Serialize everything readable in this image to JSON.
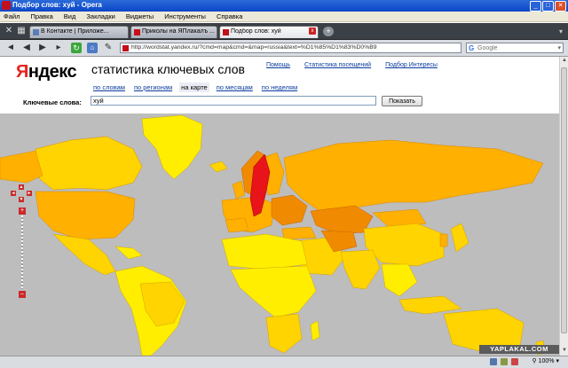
{
  "window": {
    "title": "Подбор слов: хуй - Opera"
  },
  "menu": [
    "Файл",
    "Правка",
    "Вид",
    "Закладки",
    "Виджеты",
    "Инструменты",
    "Справка"
  ],
  "tabs": [
    {
      "label": "В Контакте | Приложе...",
      "active": false
    },
    {
      "label": "Приколы на ЯПлакалъ ...",
      "active": false
    },
    {
      "label": "Подбор слов: хуй",
      "active": true
    }
  ],
  "address": {
    "url": "http://wordstat.yandex.ru/?cmd=map&cmd=&map=russia&text=%D1%85%D1%83%D0%B9",
    "search_placeholder": "Google"
  },
  "page": {
    "logo": "Яндекс",
    "heading": "статистика ключевых слов",
    "top_links": [
      "Помощь",
      "Статистика посещений",
      "Подбор Интересы"
    ],
    "subnav": [
      {
        "label": "по словам",
        "current": false
      },
      {
        "label": "по регионам",
        "current": false
      },
      {
        "label": "на карте",
        "current": true
      },
      {
        "label": "по месяцам",
        "current": false
      },
      {
        "label": "по неделям",
        "current": false
      }
    ],
    "keyword_label": "Ключевые слова:",
    "keyword_value": "хуй",
    "show_button": "Показать"
  },
  "map_controls": {
    "zoom_in": "+",
    "zoom_out": "–"
  },
  "watermark": "YAPLAKAL.COM",
  "status": {
    "zoom_level": "100%"
  },
  "colors": {
    "highest": "#e8141a",
    "high": "#f08a00",
    "medium": "#ffb000",
    "low": "#ffd800",
    "lowest": "#ffee00",
    "ocean": "#bdbdbd"
  }
}
